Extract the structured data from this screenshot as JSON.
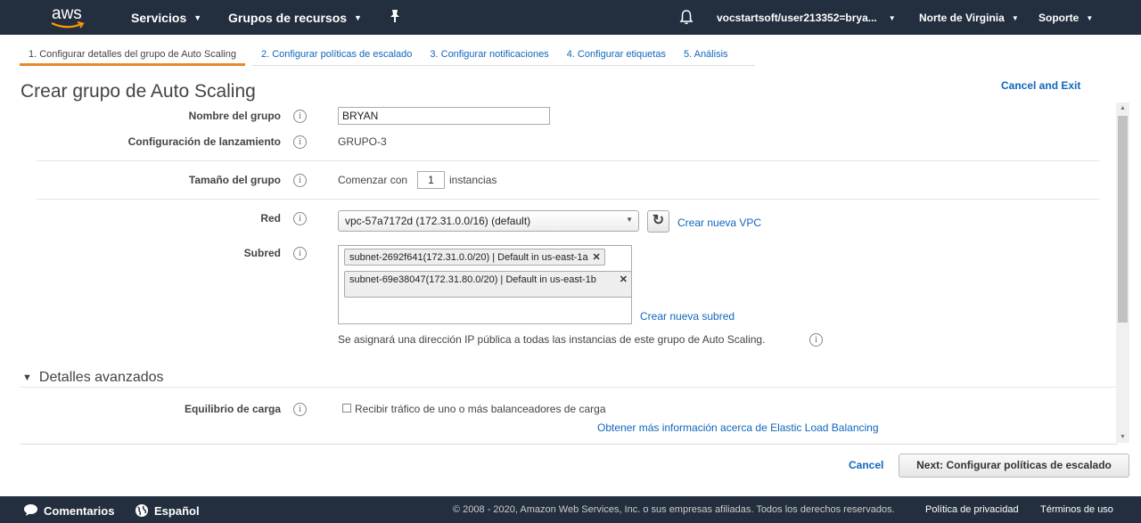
{
  "nav": {
    "logo": "aws",
    "services": "Servicios",
    "resource_groups": "Grupos de recursos",
    "user": "vocstartsoft/user213352=brya...",
    "region": "Norte de Virginia",
    "support": "Soporte"
  },
  "tabs": [
    {
      "label": "1. Configurar detalles del grupo de Auto Scaling"
    },
    {
      "label": "2. Configurar políticas de escalado"
    },
    {
      "label": "3. Configurar notificaciones"
    },
    {
      "label": "4. Configurar etiquetas"
    },
    {
      "label": "5. Análisis"
    }
  ],
  "page": {
    "title": "Crear grupo de Auto Scaling",
    "cancel_exit": "Cancel and Exit"
  },
  "form": {
    "group_name_label": "Nombre del grupo",
    "group_name_value": "BRYAN",
    "launch_config_label": "Configuración de lanzamiento",
    "launch_config_value": "GRUPO-3",
    "group_size_label": "Tamaño del grupo",
    "start_with": "Comenzar con",
    "instances_value": "1",
    "instances": "instancias",
    "network_label": "Red",
    "network_value": "vpc-57a7172d (172.31.0.0/16) (default)",
    "create_vpc": "Crear nueva VPC",
    "subnet_label": "Subred",
    "subnets": [
      {
        "label": "subnet-2692f641(172.31.0.0/20) | Default in us-east-1a"
      },
      {
        "label": "subnet-69e38047(172.31.80.0/20) | Default in us-east-1b"
      }
    ],
    "create_subnet": "Crear nueva subred",
    "public_ip_note": "Se asignará una dirección IP pública a todas las instancias de este grupo de Auto Scaling."
  },
  "advanced": {
    "title": "Detalles avanzados",
    "lb_label": "Equilibrio de carga",
    "lb_checkbox": "Recibir tráfico de uno o más balanceadores de carga",
    "lb_more": "Obtener más información acerca de Elastic Load Balancing"
  },
  "actions": {
    "cancel": "Cancel",
    "next": "Next: Configurar políticas de escalado"
  },
  "footer": {
    "feedback": "Comentarios",
    "language": "Español",
    "copyright": "© 2008 - 2020, Amazon Web Services, Inc. o sus empresas afiliadas. Todos los derechos reservados.",
    "privacy": "Política de privacidad",
    "terms": "Términos de uso"
  }
}
